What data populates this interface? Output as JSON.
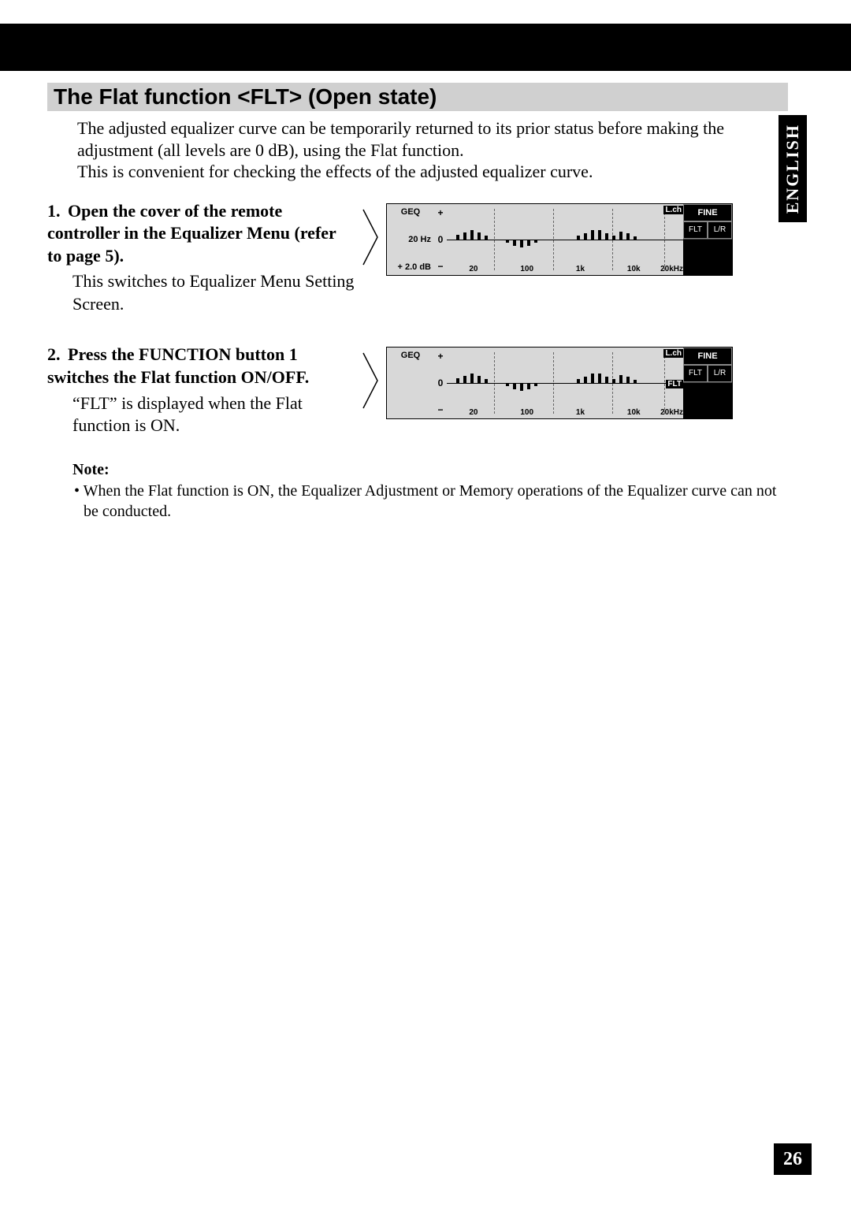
{
  "side_tab": "ENGLISH",
  "page_number": "26",
  "section_title": "The Flat function <FLT> (Open state)",
  "intro": "The adjusted equalizer curve can be temporarily returned to its prior status before making the adjustment (all levels are 0 dB), using the Flat function.\nThis is convenient for checking the effects of the adjusted equalizer curve.",
  "step1": {
    "num": "1.",
    "head": "Open the cover of the remote controller in the Equalizer Menu (refer to page 5).",
    "body": "This switches to Equalizer Menu Setting Screen."
  },
  "step2": {
    "num": "2.",
    "head": "Press the FUNCTION button 1 switches the Flat function ON/OFF.",
    "body": "“FLT” is displayed when the Flat function is ON."
  },
  "note": {
    "head": "Note:",
    "body": "• When the Flat function is ON, the Equalizer Adjustment or Memory operations of the Equalizer curve can not be conducted."
  },
  "diagram": {
    "left": {
      "geq": "GEQ",
      "freq": "20 Hz",
      "gain": "+ 2.0 dB",
      "zero": "0"
    },
    "axis": {
      "plus": "+",
      "zero": "0",
      "minus": "−"
    },
    "ticks": [
      "20",
      "100",
      "1k",
      "10k",
      "20kHz"
    ],
    "lch": "L.ch",
    "flt": "FLT",
    "right": {
      "fine": "FINE",
      "flt": "FLT",
      "lr": "L/R"
    }
  }
}
